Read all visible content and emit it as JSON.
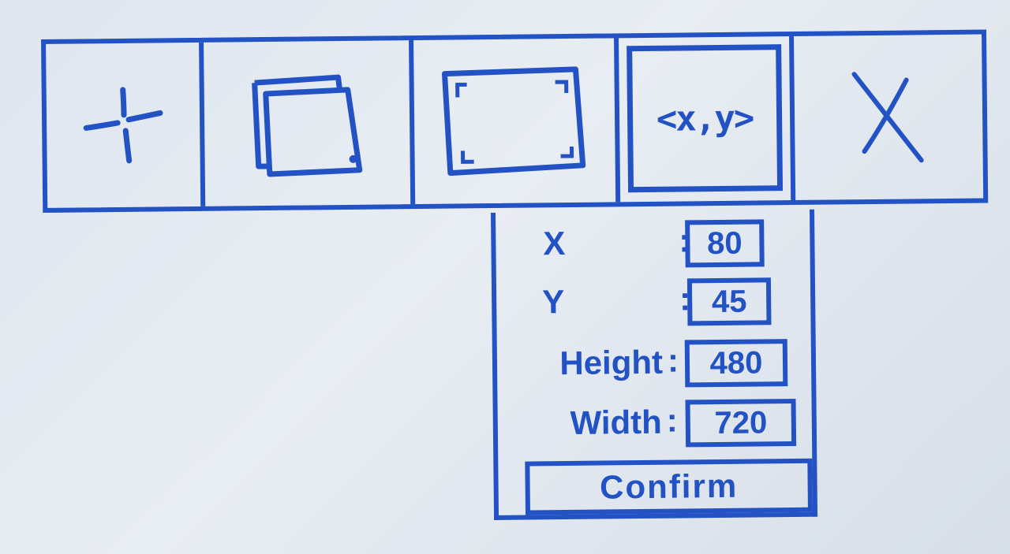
{
  "toolbar": {
    "tools": [
      {
        "name": "crosshair",
        "icon": "crosshair-icon"
      },
      {
        "name": "duplicate",
        "icon": "copy-layers-icon"
      },
      {
        "name": "selection",
        "icon": "crop-frame-icon"
      },
      {
        "name": "coordinates",
        "icon": "coordinates-icon",
        "label": "<x,y>",
        "active": true
      },
      {
        "name": "close",
        "icon": "close-icon"
      }
    ]
  },
  "panel": {
    "fields": [
      {
        "label": "X",
        "value": "80"
      },
      {
        "label": "Y",
        "value": "45"
      },
      {
        "label": "Height",
        "value": "480"
      },
      {
        "label": "Width",
        "value": "720"
      }
    ],
    "colon": ":",
    "confirm_label": "Confirm"
  },
  "colors": {
    "ink": "#2352c4",
    "background": "#e3e9ef"
  }
}
